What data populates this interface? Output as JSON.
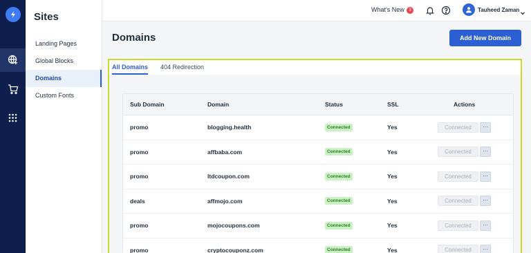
{
  "sidebar": {
    "title": "Sites",
    "items": [
      {
        "label": "Landing Pages"
      },
      {
        "label": "Global Blocks"
      },
      {
        "label": "Domains"
      },
      {
        "label": "Custom Fonts"
      }
    ]
  },
  "rail": {
    "icons": [
      "bolt-logo-icon",
      "globe-cursor-icon",
      "cart-icon",
      "apps-grid-icon"
    ]
  },
  "header": {
    "whats_new": "What's New",
    "whats_new_count": "3",
    "user_name": "Tauheed Zaman"
  },
  "page": {
    "title": "Domains",
    "add_button": "Add New Domain"
  },
  "tabs": [
    {
      "label": "All Domains"
    },
    {
      "label": "404 Redirection"
    }
  ],
  "table": {
    "columns": [
      "Sub Domain",
      "Domain",
      "Status",
      "SSL",
      "Actions"
    ],
    "rows": [
      {
        "sub": "promo",
        "domain": "blogging.health",
        "status": "Connected",
        "ssl": "Yes",
        "action": "Connected",
        "more": "···"
      },
      {
        "sub": "promo",
        "domain": "affbaba.com",
        "status": "Connected",
        "ssl": "Yes",
        "action": "Connected",
        "more": "···"
      },
      {
        "sub": "promo",
        "domain": "ltdcoupon.com",
        "status": "Connected",
        "ssl": "Yes",
        "action": "Connected",
        "more": "···"
      },
      {
        "sub": "deals",
        "domain": "affmojo.com",
        "status": "Connected",
        "ssl": "Yes",
        "action": "Connected",
        "more": "···"
      },
      {
        "sub": "promo",
        "domain": "mojocoupons.com",
        "status": "Connected",
        "ssl": "Yes",
        "action": "Connected",
        "more": "···"
      },
      {
        "sub": "promo",
        "domain": "cryptocouponz.com",
        "status": "Connected",
        "ssl": "Yes",
        "action": "Connected",
        "more": "···"
      }
    ]
  },
  "colors": {
    "rail": "#0f1f4d",
    "accent": "#2d5fd4",
    "highlight_border": "#c7dc2d",
    "status_bg": "#c9f2c3",
    "status_text": "#2e7a26"
  }
}
